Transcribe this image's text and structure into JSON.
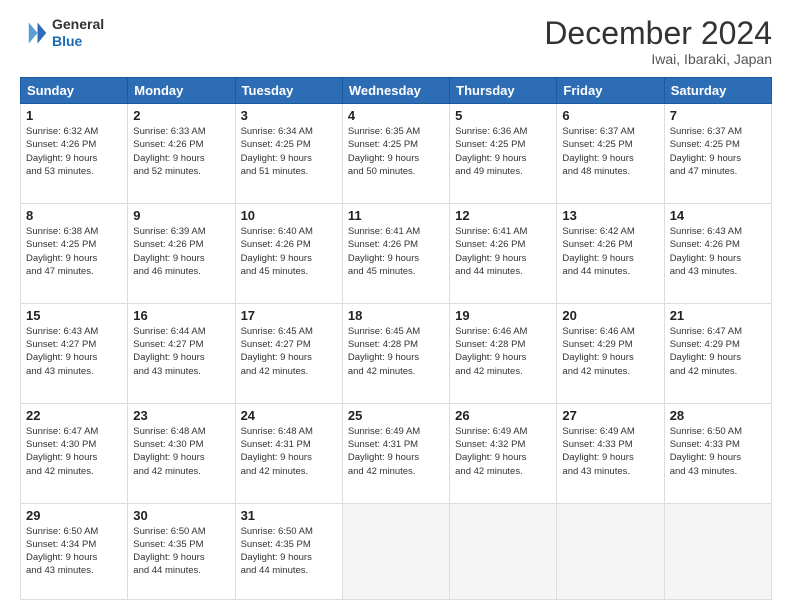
{
  "header": {
    "logo_line1": "General",
    "logo_line2": "Blue",
    "title": "December 2024",
    "subtitle": "Iwai, Ibaraki, Japan"
  },
  "columns": [
    "Sunday",
    "Monday",
    "Tuesday",
    "Wednesday",
    "Thursday",
    "Friday",
    "Saturday"
  ],
  "weeks": [
    [
      {
        "day": "1",
        "lines": [
          "Sunrise: 6:32 AM",
          "Sunset: 4:26 PM",
          "Daylight: 9 hours",
          "and 53 minutes."
        ]
      },
      {
        "day": "2",
        "lines": [
          "Sunrise: 6:33 AM",
          "Sunset: 4:26 PM",
          "Daylight: 9 hours",
          "and 52 minutes."
        ]
      },
      {
        "day": "3",
        "lines": [
          "Sunrise: 6:34 AM",
          "Sunset: 4:25 PM",
          "Daylight: 9 hours",
          "and 51 minutes."
        ]
      },
      {
        "day": "4",
        "lines": [
          "Sunrise: 6:35 AM",
          "Sunset: 4:25 PM",
          "Daylight: 9 hours",
          "and 50 minutes."
        ]
      },
      {
        "day": "5",
        "lines": [
          "Sunrise: 6:36 AM",
          "Sunset: 4:25 PM",
          "Daylight: 9 hours",
          "and 49 minutes."
        ]
      },
      {
        "day": "6",
        "lines": [
          "Sunrise: 6:37 AM",
          "Sunset: 4:25 PM",
          "Daylight: 9 hours",
          "and 48 minutes."
        ]
      },
      {
        "day": "7",
        "lines": [
          "Sunrise: 6:37 AM",
          "Sunset: 4:25 PM",
          "Daylight: 9 hours",
          "and 47 minutes."
        ]
      }
    ],
    [
      {
        "day": "8",
        "lines": [
          "Sunrise: 6:38 AM",
          "Sunset: 4:25 PM",
          "Daylight: 9 hours",
          "and 47 minutes."
        ]
      },
      {
        "day": "9",
        "lines": [
          "Sunrise: 6:39 AM",
          "Sunset: 4:26 PM",
          "Daylight: 9 hours",
          "and 46 minutes."
        ]
      },
      {
        "day": "10",
        "lines": [
          "Sunrise: 6:40 AM",
          "Sunset: 4:26 PM",
          "Daylight: 9 hours",
          "and 45 minutes."
        ]
      },
      {
        "day": "11",
        "lines": [
          "Sunrise: 6:41 AM",
          "Sunset: 4:26 PM",
          "Daylight: 9 hours",
          "and 45 minutes."
        ]
      },
      {
        "day": "12",
        "lines": [
          "Sunrise: 6:41 AM",
          "Sunset: 4:26 PM",
          "Daylight: 9 hours",
          "and 44 minutes."
        ]
      },
      {
        "day": "13",
        "lines": [
          "Sunrise: 6:42 AM",
          "Sunset: 4:26 PM",
          "Daylight: 9 hours",
          "and 44 minutes."
        ]
      },
      {
        "day": "14",
        "lines": [
          "Sunrise: 6:43 AM",
          "Sunset: 4:26 PM",
          "Daylight: 9 hours",
          "and 43 minutes."
        ]
      }
    ],
    [
      {
        "day": "15",
        "lines": [
          "Sunrise: 6:43 AM",
          "Sunset: 4:27 PM",
          "Daylight: 9 hours",
          "and 43 minutes."
        ]
      },
      {
        "day": "16",
        "lines": [
          "Sunrise: 6:44 AM",
          "Sunset: 4:27 PM",
          "Daylight: 9 hours",
          "and 43 minutes."
        ]
      },
      {
        "day": "17",
        "lines": [
          "Sunrise: 6:45 AM",
          "Sunset: 4:27 PM",
          "Daylight: 9 hours",
          "and 42 minutes."
        ]
      },
      {
        "day": "18",
        "lines": [
          "Sunrise: 6:45 AM",
          "Sunset: 4:28 PM",
          "Daylight: 9 hours",
          "and 42 minutes."
        ]
      },
      {
        "day": "19",
        "lines": [
          "Sunrise: 6:46 AM",
          "Sunset: 4:28 PM",
          "Daylight: 9 hours",
          "and 42 minutes."
        ]
      },
      {
        "day": "20",
        "lines": [
          "Sunrise: 6:46 AM",
          "Sunset: 4:29 PM",
          "Daylight: 9 hours",
          "and 42 minutes."
        ]
      },
      {
        "day": "21",
        "lines": [
          "Sunrise: 6:47 AM",
          "Sunset: 4:29 PM",
          "Daylight: 9 hours",
          "and 42 minutes."
        ]
      }
    ],
    [
      {
        "day": "22",
        "lines": [
          "Sunrise: 6:47 AM",
          "Sunset: 4:30 PM",
          "Daylight: 9 hours",
          "and 42 minutes."
        ]
      },
      {
        "day": "23",
        "lines": [
          "Sunrise: 6:48 AM",
          "Sunset: 4:30 PM",
          "Daylight: 9 hours",
          "and 42 minutes."
        ]
      },
      {
        "day": "24",
        "lines": [
          "Sunrise: 6:48 AM",
          "Sunset: 4:31 PM",
          "Daylight: 9 hours",
          "and 42 minutes."
        ]
      },
      {
        "day": "25",
        "lines": [
          "Sunrise: 6:49 AM",
          "Sunset: 4:31 PM",
          "Daylight: 9 hours",
          "and 42 minutes."
        ]
      },
      {
        "day": "26",
        "lines": [
          "Sunrise: 6:49 AM",
          "Sunset: 4:32 PM",
          "Daylight: 9 hours",
          "and 42 minutes."
        ]
      },
      {
        "day": "27",
        "lines": [
          "Sunrise: 6:49 AM",
          "Sunset: 4:33 PM",
          "Daylight: 9 hours",
          "and 43 minutes."
        ]
      },
      {
        "day": "28",
        "lines": [
          "Sunrise: 6:50 AM",
          "Sunset: 4:33 PM",
          "Daylight: 9 hours",
          "and 43 minutes."
        ]
      }
    ],
    [
      {
        "day": "29",
        "lines": [
          "Sunrise: 6:50 AM",
          "Sunset: 4:34 PM",
          "Daylight: 9 hours",
          "and 43 minutes."
        ]
      },
      {
        "day": "30",
        "lines": [
          "Sunrise: 6:50 AM",
          "Sunset: 4:35 PM",
          "Daylight: 9 hours",
          "and 44 minutes."
        ]
      },
      {
        "day": "31",
        "lines": [
          "Sunrise: 6:50 AM",
          "Sunset: 4:35 PM",
          "Daylight: 9 hours",
          "and 44 minutes."
        ]
      },
      null,
      null,
      null,
      null
    ]
  ]
}
